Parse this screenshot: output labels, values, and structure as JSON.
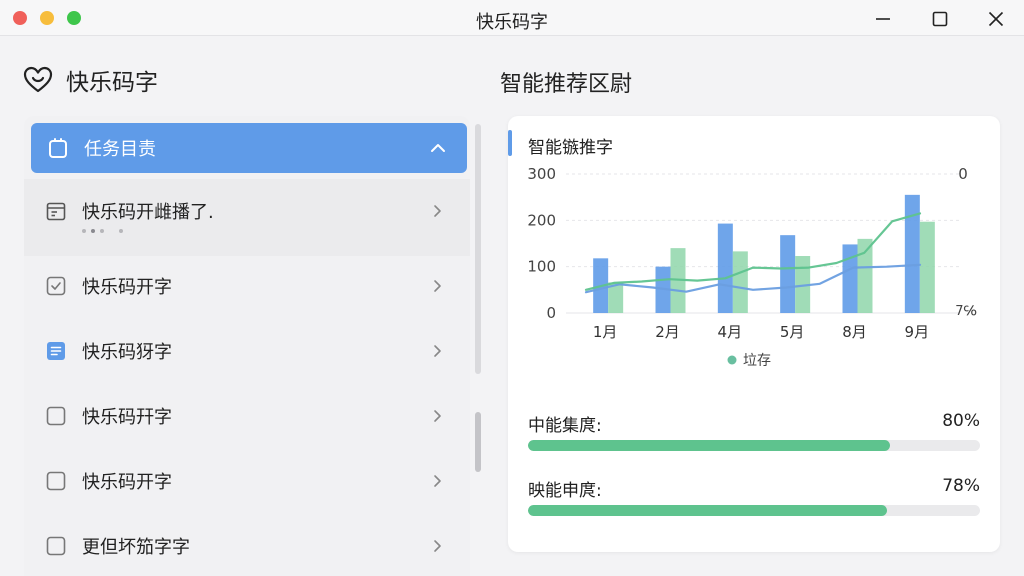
{
  "window": {
    "title": "快乐码字"
  },
  "brand": {
    "name": "快乐码字",
    "icon": "heart-logo-icon"
  },
  "list": {
    "header": {
      "label": "任务目责",
      "icon": "clipboard-icon",
      "expanded": true
    },
    "expanded_item": {
      "label": "快乐码开雌播了.",
      "icon": "calendar-icon",
      "dots": 4,
      "active_dot": 1
    },
    "items": [
      {
        "label": "快乐码开字",
        "icon": "check-square-icon",
        "active": false
      },
      {
        "label": "快乐码犽字",
        "icon": "note-icon",
        "active": true
      },
      {
        "label": "快乐码幵字",
        "icon": "square-icon",
        "active": false
      },
      {
        "label": "快乐码开字",
        "icon": "square-icon",
        "active": false
      },
      {
        "label": "更但坏笳字字",
        "icon": "square-icon",
        "active": false
      }
    ]
  },
  "right": {
    "section_title": "智能推荐区尉",
    "card_title": "智能镞推字",
    "progress": [
      {
        "label": "中能集庹:",
        "value_text": "80%",
        "value": 0.8,
        "color": "#5ec38e"
      },
      {
        "label": "映能申庹:",
        "value_text": "78%",
        "value": 0.795,
        "color": "#5ec38e"
      }
    ]
  },
  "chart_data": {
    "type": "bar",
    "categories": [
      "1月",
      "2月",
      "4月",
      "5月",
      "8月",
      "9月"
    ],
    "y_ticks": [
      "300",
      "200",
      "100",
      "0"
    ],
    "ylim": [
      0,
      300
    ],
    "right_axis_labels": {
      "top": "0",
      "bottom": "7℅"
    },
    "series": [
      {
        "values": [
          118,
          100,
          193,
          168,
          148,
          255
        ],
        "color": "#5f9be8"
      },
      {
        "values": [
          66,
          140,
          133,
          123,
          160,
          197
        ],
        "color": "#8fd6aa"
      }
    ],
    "lines": [
      {
        "values": [
          45,
          62,
          55,
          46,
          62,
          50,
          55,
          63,
          98,
          100,
          104
        ],
        "color": "#6a9ee0"
      },
      {
        "values": [
          50,
          65,
          68,
          73,
          70,
          75,
          98,
          96,
          98,
          108,
          130,
          198,
          215
        ],
        "color": "#5ec38e"
      }
    ],
    "legend": {
      "label": "垃存",
      "color": "#69bfa0"
    }
  }
}
